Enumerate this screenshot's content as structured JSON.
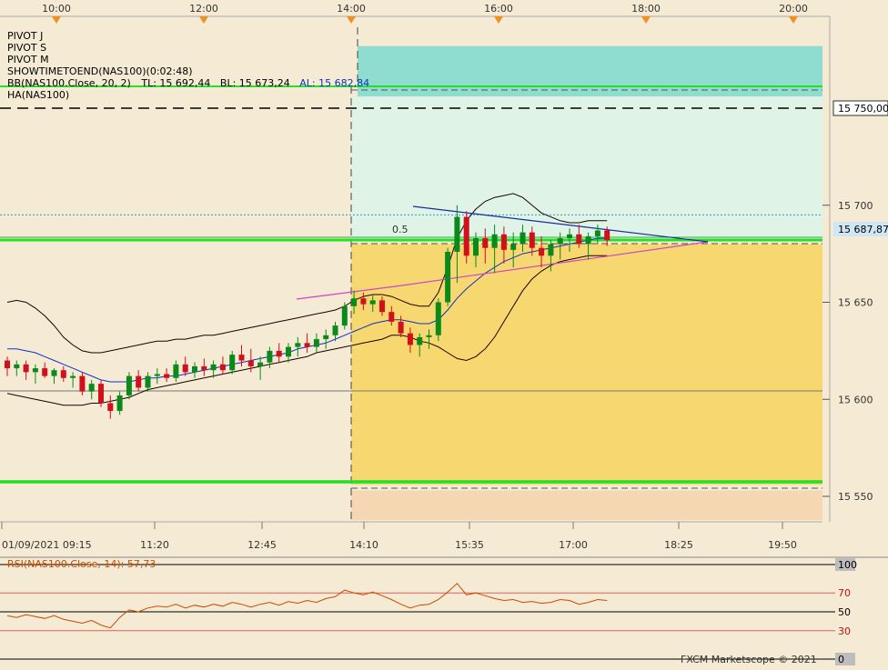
{
  "title": "NAS100",
  "watermark": "FXCM Marketscope © 2021",
  "colors": {
    "background": "#f5ead3",
    "bull": "#0a8a1a",
    "bear": "#d0101a",
    "bb_band": "#1a0000",
    "bb_mid": "#1030c8",
    "pivot_green": "#22e022",
    "teal_zone": "#8fdcd0",
    "mint_zone": "#dff3e6",
    "yellow_zone": "#f7d870",
    "peach_zone": "#f6d7b3",
    "magenta": "#cc44cc",
    "rsi_line": "#cc4a00",
    "rsi_ref": "#e06060",
    "price_box": "#cfe6f5"
  },
  "top_axis": {
    "labels": [
      "10:00",
      "12:00",
      "14:00",
      "16:00",
      "18:00",
      "20:00"
    ],
    "marker": "down-triangle"
  },
  "legend": [
    "PIVOT J",
    "PIVOT S",
    "PIVOT M",
    "SHOWTIMETOEND(NAS100)(0:02:48)",
    {
      "label": "BB(NAS100.Close, 20, 2)",
      "tl": "TL: 15 692,44",
      "bl": "BL: 15 673,24",
      "al": "AL: 15 682,84"
    },
    "HA(NAS100)"
  ],
  "price_axis": {
    "ticks": [
      "15 550",
      "15 600",
      "15 650",
      "15 700"
    ],
    "tick_values": [
      15550,
      15600,
      15650,
      15700
    ],
    "highlight": "15 750,00",
    "highlight_value": 15750,
    "current": "15 687,87",
    "current_value": 15687.87
  },
  "fib_label": "0.5",
  "chart_data": {
    "type": "candlestick",
    "series_name": "NAS100",
    "interval_minutes": 5,
    "x_labels": [
      "01/09/2021 09:15",
      "11:20",
      "12:45",
      "14:10",
      "15:35",
      "17:00",
      "18:25",
      "19:50"
    ],
    "ylim": [
      15530,
      15780
    ],
    "candles": [
      [
        15620,
        15622,
        15612,
        15616
      ],
      [
        15616,
        15620,
        15612,
        15618
      ],
      [
        15618,
        15620,
        15610,
        15614
      ],
      [
        15614,
        15618,
        15608,
        15616
      ],
      [
        15616,
        15619,
        15611,
        15612
      ],
      [
        15612,
        15616,
        15608,
        15615
      ],
      [
        15615,
        15617,
        15609,
        15611
      ],
      [
        15611,
        15614,
        15606,
        15612
      ],
      [
        15612,
        15614,
        15602,
        15604
      ],
      [
        15604,
        15610,
        15600,
        15608
      ],
      [
        15608,
        15610,
        15596,
        15598
      ],
      [
        15598,
        15602,
        15590,
        15594
      ],
      [
        15594,
        15604,
        15592,
        15602
      ],
      [
        15602,
        15614,
        15600,
        15612
      ],
      [
        15612,
        15615,
        15604,
        15606
      ],
      [
        15606,
        15614,
        15604,
        15612
      ],
      [
        15612,
        15616,
        15608,
        15613
      ],
      [
        15613,
        15616,
        15609,
        15611
      ],
      [
        15611,
        15620,
        15609,
        15618
      ],
      [
        15618,
        15622,
        15612,
        15614
      ],
      [
        15614,
        15619,
        15611,
        15617
      ],
      [
        15617,
        15621,
        15612,
        15615
      ],
      [
        15615,
        15620,
        15611,
        15618
      ],
      [
        15618,
        15622,
        15613,
        15615
      ],
      [
        15615,
        15625,
        15613,
        15623
      ],
      [
        15623,
        15628,
        15617,
        15620
      ],
      [
        15620,
        15626,
        15614,
        15617
      ],
      [
        15617,
        15622,
        15610,
        15619
      ],
      [
        15619,
        15627,
        15616,
        15625
      ],
      [
        15625,
        15629,
        15619,
        15622
      ],
      [
        15622,
        15629,
        15619,
        15627
      ],
      [
        15627,
        15632,
        15622,
        15629
      ],
      [
        15629,
        15634,
        15624,
        15627
      ],
      [
        15627,
        15634,
        15624,
        15631
      ],
      [
        15631,
        15636,
        15626,
        15633
      ],
      [
        15633,
        15640,
        15630,
        15638
      ],
      [
        15638,
        15650,
        15636,
        15648
      ],
      [
        15648,
        15656,
        15644,
        15652
      ],
      [
        15652,
        15655,
        15646,
        15649
      ],
      [
        15649,
        15654,
        15645,
        15651
      ],
      [
        15651,
        15653,
        15643,
        15645
      ],
      [
        15645,
        15648,
        15638,
        15640
      ],
      [
        15640,
        15643,
        15632,
        15634
      ],
      [
        15634,
        15637,
        15624,
        15628
      ],
      [
        15628,
        15634,
        15622,
        15632
      ],
      [
        15632,
        15636,
        15626,
        15633
      ],
      [
        15633,
        15652,
        15630,
        15650
      ],
      [
        15650,
        15678,
        15648,
        15676
      ],
      [
        15676,
        15700,
        15660,
        15694
      ],
      [
        15694,
        15697,
        15670,
        15674
      ],
      [
        15674,
        15686,
        15668,
        15683
      ],
      [
        15683,
        15688,
        15670,
        15678
      ],
      [
        15678,
        15690,
        15665,
        15685
      ],
      [
        15685,
        15689,
        15670,
        15677
      ],
      [
        15677,
        15686,
        15668,
        15680
      ],
      [
        15680,
        15690,
        15676,
        15686
      ],
      [
        15686,
        15689,
        15674,
        15678
      ],
      [
        15678,
        15684,
        15668,
        15674
      ],
      [
        15674,
        15682,
        15666,
        15680
      ],
      [
        15680,
        15686,
        15672,
        15683
      ],
      [
        15683,
        15688,
        15676,
        15685
      ],
      [
        15685,
        15690,
        15678,
        15680
      ],
      [
        15680,
        15686,
        15672,
        15684
      ],
      [
        15684,
        15690,
        15680,
        15687
      ],
      [
        15687,
        15689,
        15679,
        15682
      ]
    ],
    "bollinger": {
      "params": "BB(NAS100.Close, 20, 2)",
      "upper": [
        15650,
        15651,
        15650,
        15647,
        15643,
        15638,
        15632,
        15628,
        15625,
        15624,
        15624,
        15625,
        15626,
        15627,
        15628,
        15629,
        15630,
        15630,
        15631,
        15631,
        15632,
        15633,
        15633,
        15634,
        15635,
        15636,
        15637,
        15638,
        15639,
        15640,
        15641,
        15642,
        15643,
        15644,
        15645,
        15646,
        15648,
        15651,
        15653,
        15654,
        15654,
        15653,
        15651,
        15649,
        15648,
        15648,
        15655,
        15668,
        15683,
        15692,
        15698,
        15702,
        15704,
        15705,
        15706,
        15704,
        15700,
        15696,
        15694,
        15692,
        15691,
        15691,
        15692,
        15692,
        15692
      ],
      "middle": [
        15626,
        15626,
        15625,
        15624,
        15622,
        15620,
        15618,
        15616,
        15614,
        15612,
        15610,
        15609,
        15609,
        15609,
        15610,
        15611,
        15611,
        15612,
        15612,
        15613,
        15614,
        15615,
        15616,
        15617,
        15618,
        15619,
        15620,
        15621,
        15622,
        15623,
        15624,
        15626,
        15627,
        15628,
        15629,
        15631,
        15633,
        15635,
        15637,
        15639,
        15640,
        15641,
        15641,
        15640,
        15639,
        15639,
        15641,
        15646,
        15652,
        15657,
        15661,
        15665,
        15668,
        15671,
        15673,
        15675,
        15676,
        15677,
        15678,
        15679,
        15680,
        15681,
        15682,
        15683,
        15683
      ],
      "lower": [
        15603,
        15602,
        15601,
        15600,
        15599,
        15598,
        15597,
        15597,
        15597,
        15598,
        15598,
        15599,
        15600,
        15601,
        15603,
        15605,
        15606,
        15607,
        15608,
        15609,
        15610,
        15611,
        15612,
        15613,
        15614,
        15615,
        15616,
        15617,
        15618,
        15619,
        15620,
        15621,
        15622,
        15624,
        15625,
        15626,
        15627,
        15628,
        15629,
        15630,
        15631,
        15633,
        15633,
        15632,
        15630,
        15629,
        15627,
        15624,
        15621,
        15620,
        15622,
        15626,
        15632,
        15640,
        15648,
        15656,
        15662,
        15666,
        15669,
        15671,
        15672,
        15673,
        15674,
        15674,
        15674
      ]
    },
    "pivot_lines": [
      15750,
      15682,
      15680,
      15556
    ],
    "zones": [
      {
        "name": "teal",
        "from": 15756,
        "to": 15782
      },
      {
        "name": "mint",
        "from": 15682,
        "to": 15756
      },
      {
        "name": "yellow",
        "from": 15556,
        "to": 15680
      },
      {
        "name": "peach",
        "from": 15532,
        "to": 15553
      }
    ],
    "rsi": {
      "label": "RSI(NAS100.Close, 14): 57,73",
      "levels": [
        100,
        70,
        50,
        30,
        0
      ],
      "values": [
        46,
        44,
        47,
        45,
        43,
        46,
        42,
        40,
        38,
        41,
        36,
        33,
        44,
        52,
        50,
        54,
        56,
        55,
        58,
        54,
        57,
        55,
        58,
        56,
        60,
        58,
        55,
        58,
        60,
        57,
        61,
        59,
        62,
        60,
        64,
        66,
        73,
        70,
        68,
        71,
        67,
        63,
        58,
        54,
        57,
        58,
        63,
        71,
        80,
        68,
        70,
        67,
        64,
        62,
        63,
        60,
        61,
        59,
        60,
        63,
        62,
        58,
        60,
        63,
        62
      ]
    }
  }
}
